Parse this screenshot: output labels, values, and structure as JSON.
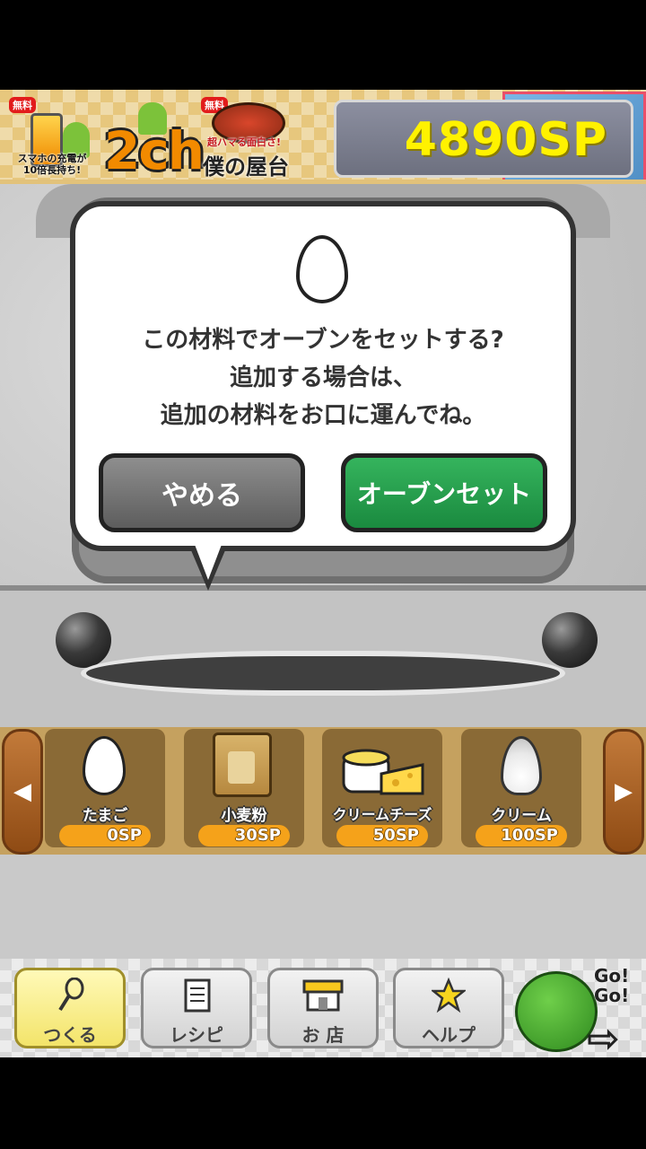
{
  "header": {
    "ads": [
      {
        "badge": "無料",
        "caption": "スマホの充電が\n10倍長持ち!"
      },
      {
        "badge": "",
        "caption": "2ch"
      },
      {
        "badge": "無料",
        "caption_top": "超ハマる面白さ!",
        "caption": "僕の屋台"
      }
    ],
    "points": "4890SP"
  },
  "dialog": {
    "line1": "この材料でオーブンをセットする?",
    "line2": "追加する場合は、",
    "line3": "追加の材料をお口に運んでね。",
    "cancel": "やめる",
    "confirm": "オーブンセット"
  },
  "ingredients": [
    {
      "name": "たまご",
      "price": "0SP",
      "icon": "egg-icon"
    },
    {
      "name": "小麦粉",
      "price": "30SP",
      "icon": "flour-icon"
    },
    {
      "name": "クリームチーズ",
      "price": "50SP",
      "icon": "cream-cheese-icon"
    },
    {
      "name": "クリーム",
      "price": "100SP",
      "icon": "whipped-cream-icon"
    }
  ],
  "nav": {
    "items": [
      {
        "label": "つくる",
        "icon": "whisk-icon",
        "active": true
      },
      {
        "label": "レシピ",
        "icon": "notepad-icon",
        "active": false
      },
      {
        "label": "お 店",
        "icon": "shop-icon",
        "active": false
      },
      {
        "label": "ヘルプ",
        "icon": "star-icon",
        "active": false
      }
    ],
    "go": "Go!\nGo!"
  },
  "colors": {
    "points": "#fff200",
    "confirm_button": "#1f9a48",
    "cancel_button": "#6e6e6e",
    "price_badge": "#f5a21a"
  }
}
